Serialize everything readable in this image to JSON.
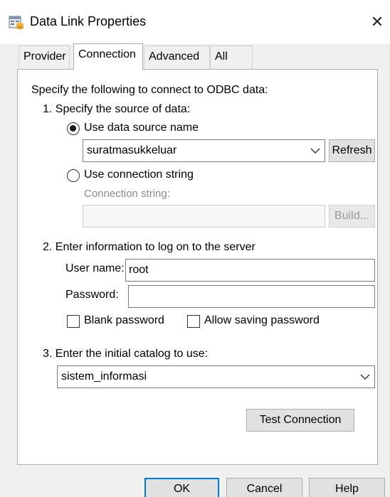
{
  "window": {
    "title": "Data Link Properties",
    "close_glyph": "✕",
    "icon": "data-link-icon"
  },
  "tabs": [
    {
      "label": "Provider",
      "active": false
    },
    {
      "label": "Connection",
      "active": true
    },
    {
      "label": "Advanced",
      "active": false
    },
    {
      "label": "All",
      "active": false
    }
  ],
  "connection": {
    "intro": "Specify the following to connect to ODBC data:",
    "step1": {
      "heading": "1. Specify the source of data:",
      "use_dsn_label": "Use data source name",
      "use_dsn_selected": true,
      "dsn_value": "suratmasukkeluar",
      "refresh_label": "Refresh",
      "use_connstr_label": "Use connection string",
      "use_connstr_selected": false,
      "connstr_caption": "Connection string:",
      "connstr_value": "",
      "build_label": "Build..."
    },
    "step2": {
      "heading": "2. Enter information to log on to the server",
      "username_label": "User name:",
      "username_value": "root",
      "password_label": "Password:",
      "password_value": "",
      "blank_password_label": "Blank password",
      "blank_password_checked": false,
      "allow_saving_label": "Allow saving password",
      "allow_saving_checked": false
    },
    "step3": {
      "heading": "3. Enter the initial catalog to use:",
      "catalog_value": "sistem_informasi"
    },
    "test_connection_label": "Test Connection"
  },
  "footer": {
    "ok_label": "OK",
    "cancel_label": "Cancel",
    "help_label": "Help"
  },
  "colors": {
    "dialog_bg": "#f0f0f0",
    "panel_bg": "#ffffff",
    "focus_border": "#0078d7",
    "disabled_text": "#8a8a8a"
  }
}
